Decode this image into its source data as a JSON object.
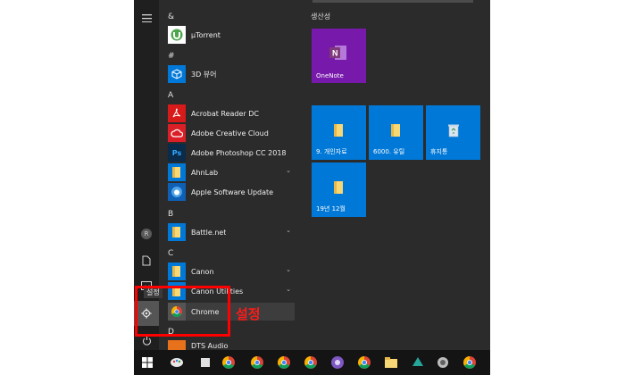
{
  "colors": {
    "onenote": "#7719aa",
    "blue_tile": "#0078d7",
    "folder": "#f8d775",
    "chrome_red": "#db4437",
    "annotation": "#ff0000"
  },
  "rail": {
    "menu_icon": "hamburger-icon",
    "avatar_letter": "R",
    "settings_tooltip": "설정"
  },
  "apps": {
    "sections": [
      {
        "header": "&",
        "items": [
          {
            "label": "µTorrent",
            "icon": "utorrent-icon"
          }
        ]
      },
      {
        "header": "#",
        "items": [
          {
            "label": "3D 뷰어",
            "icon": "3d-viewer-icon"
          }
        ]
      },
      {
        "header": "A",
        "items": [
          {
            "label": "Acrobat Reader DC",
            "icon": "acrobat-icon"
          },
          {
            "label": "Adobe Creative Cloud",
            "icon": "creative-cloud-icon"
          },
          {
            "label": "Adobe Photoshop CC 2018",
            "icon": "photoshop-icon"
          },
          {
            "label": "AhnLab",
            "icon": "folder-icon"
          },
          {
            "label": "Apple Software Update",
            "icon": "apple-update-icon"
          }
        ]
      },
      {
        "header": "B",
        "items": [
          {
            "label": "Battle.net",
            "icon": "folder-icon"
          }
        ]
      },
      {
        "header": "C",
        "items": [
          {
            "label": "Canon",
            "icon": "folder-icon"
          },
          {
            "label": "Canon Utilities",
            "icon": "folder-icon"
          },
          {
            "label": "Chrome",
            "icon": "chrome-icon"
          }
        ]
      },
      {
        "header": "D",
        "items": [
          {
            "label": "DTS Audio",
            "icon": "dts-icon"
          }
        ]
      }
    ]
  },
  "tiles": {
    "group_title": "생산성",
    "items": [
      {
        "label": "OneNote",
        "icon": "onenote-icon"
      },
      {
        "label": "9. 개인자료",
        "icon": "folder-icon"
      },
      {
        "label": "6000. 유틸",
        "icon": "folder-icon"
      },
      {
        "label": "휴지통",
        "icon": "recycle-bin-icon"
      },
      {
        "label": "19년 12월",
        "icon": "folder-icon"
      }
    ]
  },
  "taskbar": {
    "icons": [
      "windows-start-icon",
      "paint-icon",
      "chrome-icon",
      "chrome-icon",
      "chrome-icon",
      "chrome-icon",
      "chrome-icon",
      "media-icon",
      "chrome-icon",
      "chrome-icon",
      "file-explorer-icon",
      "app-icon",
      "app-icon",
      "chrome-icon"
    ]
  },
  "annotation": {
    "text": "설정"
  }
}
